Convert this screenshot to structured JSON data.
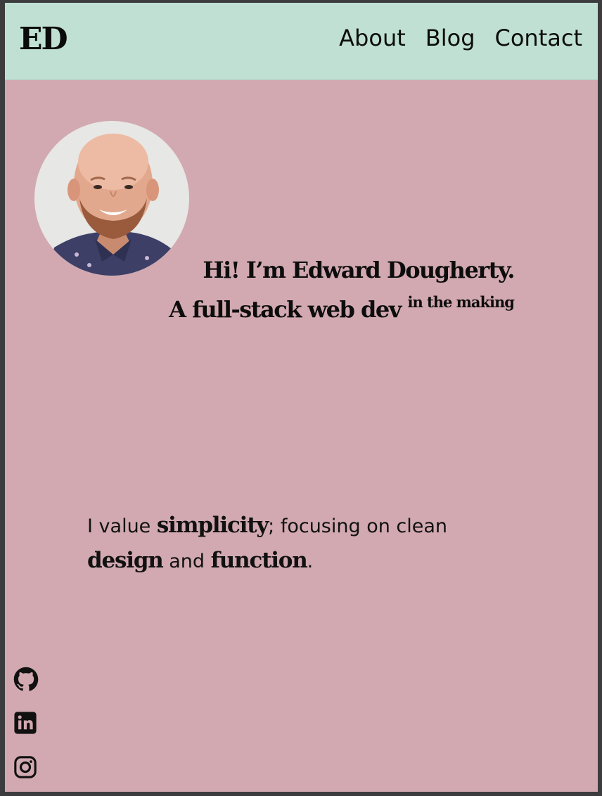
{
  "header": {
    "logo": "ED",
    "nav": [
      {
        "label": "About"
      },
      {
        "label": "Blog"
      },
      {
        "label": "Contact"
      }
    ]
  },
  "hero": {
    "greeting": "Hi! I’m Edward Dougherty.",
    "role": "A full-stack web dev",
    "role_superscript": "in the making"
  },
  "tagline": {
    "part1": "I value ",
    "bold1": "simplicity",
    "part2": "; focusing on clean ",
    "bold2": "design",
    "part3": " and ",
    "bold3": "function",
    "part4": "."
  },
  "social": [
    {
      "icon": "github-icon"
    },
    {
      "icon": "linkedin-icon"
    },
    {
      "icon": "instagram-icon"
    }
  ],
  "colors": {
    "header_bg": "#bfe0d3",
    "page_bg": "#d2a9b1",
    "text": "#0d0d0d"
  }
}
